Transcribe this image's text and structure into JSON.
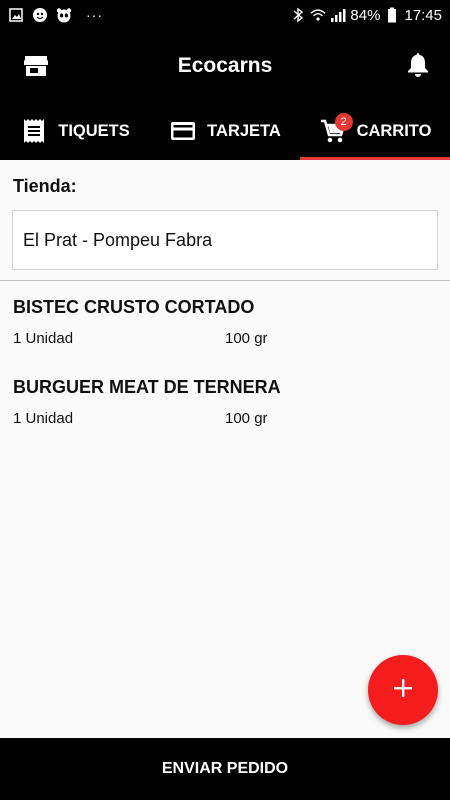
{
  "status_bar": {
    "battery": "84%",
    "time": "17:45",
    "more": "···",
    "icons": [
      "image-icon",
      "app-icon",
      "panda-icon",
      "bluetooth-icon",
      "wifi-icon",
      "signal-icon",
      "battery-icon"
    ]
  },
  "app_bar": {
    "title": "Ecocarns",
    "left_icon": "store-icon",
    "right_icon": "bell-icon"
  },
  "tabs": [
    {
      "label": "TIQUETS",
      "icon": "receipt-icon",
      "active": false
    },
    {
      "label": "TARJETA",
      "icon": "credit-card-icon",
      "active": false
    },
    {
      "label": "CARRITO",
      "icon": "cart-icon",
      "active": true,
      "badge": "2"
    }
  ],
  "store": {
    "label": "Tienda:",
    "value": "El Prat - Pompeu Fabra"
  },
  "products": [
    {
      "name": "BISTEC CRUSTO CORTADO",
      "quantity": "1 Unidad",
      "weight": "100 gr"
    },
    {
      "name": "BURGUER MEAT DE TERNERA",
      "quantity": "1 Unidad",
      "weight": "100 gr"
    }
  ],
  "fab": {
    "icon": "plus-icon"
  },
  "footer": {
    "submit_label": "ENVIAR PEDIDO"
  },
  "colors": {
    "accent": "#e53935",
    "fab": "#f41c1c",
    "bar": "#000000"
  }
}
